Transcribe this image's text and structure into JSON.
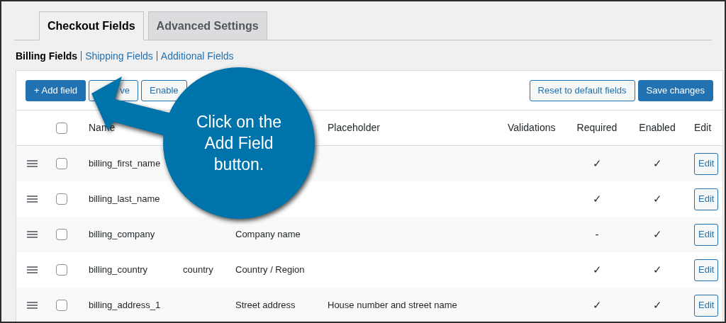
{
  "tabs": [
    {
      "label": "Checkout Fields",
      "selected": true
    },
    {
      "label": "Advanced Settings",
      "selected": false
    }
  ],
  "sections": [
    {
      "label": "Billing Fields",
      "selected": true
    },
    {
      "label": "Shipping Fields",
      "selected": false
    },
    {
      "label": "Additional Fields",
      "selected": false
    }
  ],
  "toolbar": {
    "left": [
      {
        "label": "+ Add field",
        "kind": "primary"
      },
      {
        "label": "ve",
        "kind": "secondary"
      },
      {
        "label": "Enable",
        "kind": "secondary"
      }
    ],
    "right": [
      {
        "label": "Reset to default fields",
        "kind": "outline"
      },
      {
        "label": "Save changes",
        "kind": "primary"
      }
    ]
  },
  "table": {
    "all_checked": false,
    "columns": [
      "Name",
      "",
      "",
      "Placeholder",
      "Validations",
      "Required",
      "Enabled",
      "Edit"
    ],
    "rows": [
      {
        "checked": false,
        "name": "billing_first_name",
        "type": "",
        "label": "",
        "placeholder": "",
        "validations": "",
        "required": "✓",
        "enabled": "✓",
        "edit": "Edit"
      },
      {
        "checked": false,
        "name": "billing_last_name",
        "type": "",
        "label": "",
        "placeholder": "",
        "validations": "",
        "required": "✓",
        "enabled": "✓",
        "edit": "Edit"
      },
      {
        "checked": false,
        "name": "billing_company",
        "type": "",
        "label": "Company name",
        "placeholder": "",
        "validations": "",
        "required": "-",
        "enabled": "✓",
        "edit": "Edit"
      },
      {
        "checked": false,
        "name": "billing_country",
        "type": "country",
        "label": "Country / Region",
        "placeholder": "",
        "validations": "",
        "required": "✓",
        "enabled": "✓",
        "edit": "Edit"
      },
      {
        "checked": false,
        "name": "billing_address_1",
        "type": "",
        "label": "Street address",
        "placeholder": "House number and street name",
        "validations": "",
        "required": "✓",
        "enabled": "✓",
        "edit": "Edit"
      }
    ]
  },
  "callout": {
    "text": "Click on the Add Field button."
  }
}
